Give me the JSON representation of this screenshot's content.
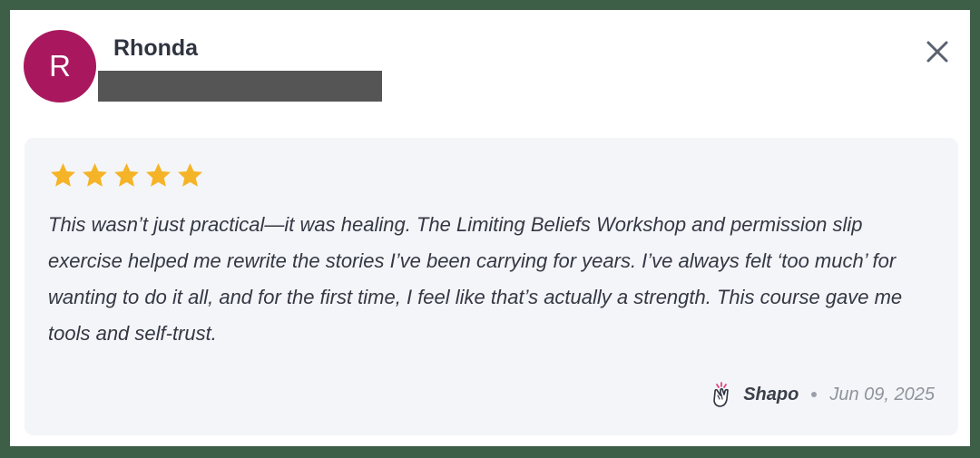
{
  "reviewer": {
    "initial": "R",
    "name": "Rhonda",
    "avatar_color": "#a9185f"
  },
  "review": {
    "rating": 5,
    "max_rating": 5,
    "star_color": "#f5b428",
    "text": "This wasn’t just practical—it was healing. The Limiting Beliefs Workshop and permission slip exercise helped me rewrite the stories I’ve been carrying for years. I’ve always felt ‘too much’ for wanting to do it all, and for the first time, I feel like that’s actually a strength. This course gave me tools and self-trust."
  },
  "footer": {
    "brand": "Shapo",
    "brand_icon": "clapping-hands-icon",
    "date": "Jun 09, 2025"
  },
  "icons": {
    "close": "close-icon"
  },
  "colors": {
    "frame": "#3d5e47",
    "card": "#ffffff",
    "review_background": "#f4f5f8",
    "redaction": "#555555"
  }
}
